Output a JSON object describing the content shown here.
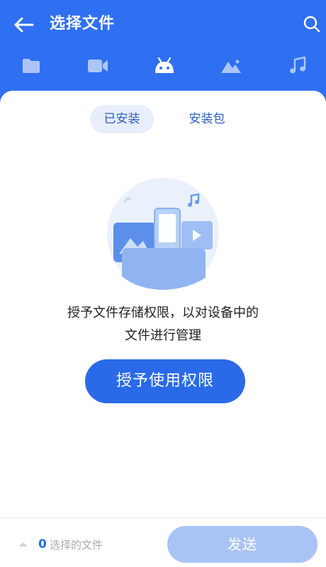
{
  "header": {
    "title": "选择文件",
    "back_icon": "back-arrow-icon",
    "search_icon": "search-icon"
  },
  "tabs": [
    {
      "name": "folder",
      "icon": "folder-icon",
      "active": false
    },
    {
      "name": "video",
      "icon": "video-icon",
      "active": false
    },
    {
      "name": "apps",
      "icon": "android-icon",
      "active": true
    },
    {
      "name": "images",
      "icon": "image-icon",
      "active": false
    },
    {
      "name": "music",
      "icon": "music-note-icon",
      "active": false
    }
  ],
  "segments": {
    "installed": "已安装",
    "packages": "安装包",
    "selected": "installed"
  },
  "empty_state": {
    "message_line1": "授予文件存储权限，以对设备中的",
    "message_line2": "文件进行管理",
    "button_label": "授予使用权限"
  },
  "footer": {
    "count": "0",
    "count_label": "选择的文件",
    "send_label": "发送"
  },
  "colors": {
    "brand_blue": "#2f6ff2",
    "button_blue": "#2a6ae8",
    "disabled_blue": "#a9c3f6"
  }
}
